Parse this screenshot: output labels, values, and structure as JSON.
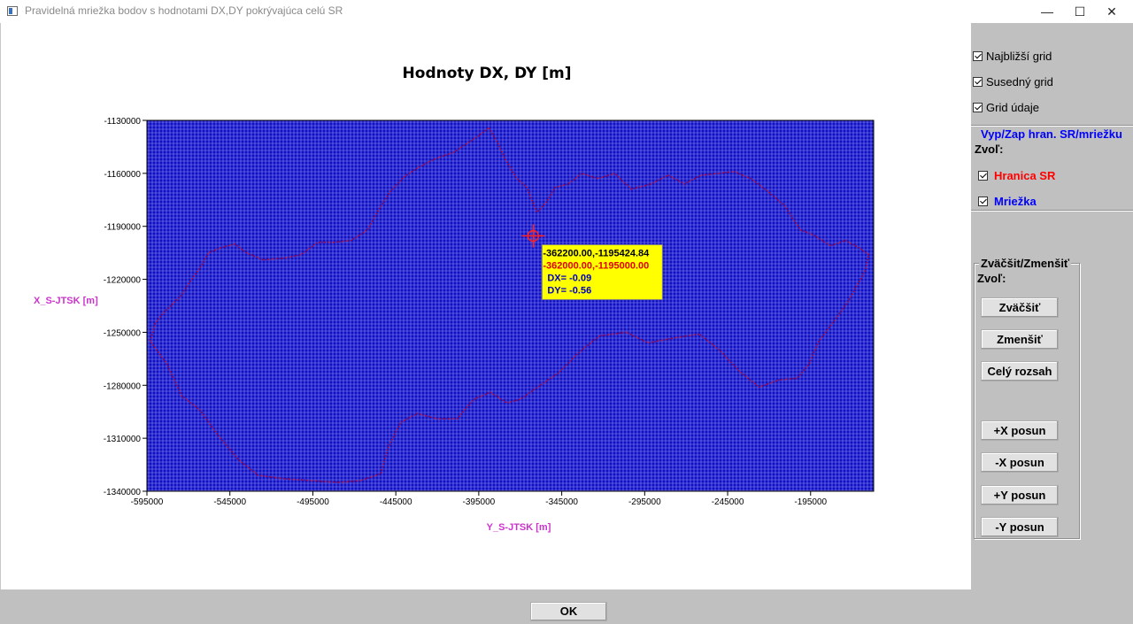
{
  "window": {
    "title": "Pravidelná mriežka bodov s hodnotami DX,DY pokrývajúca celú SR",
    "minimize_icon": "minimize-icon",
    "maximize_icon": "maximize-icon",
    "close_icon": "close-icon"
  },
  "chart_data": {
    "type": "scatter",
    "title": "Hodnoty DX, DY [m]",
    "xlabel": "Y_S-JTSK [m]",
    "ylabel": "X_S-JTSK [m]",
    "xlim": [
      -595000,
      -157000
    ],
    "ylim": [
      -1340000,
      -1130000
    ],
    "x_ticks": [
      -595000,
      -545000,
      -495000,
      -445000,
      -395000,
      -345000,
      -295000,
      -245000,
      -195000
    ],
    "y_ticks": [
      -1130000,
      -1160000,
      -1190000,
      -1220000,
      -1250000,
      -1280000,
      -1310000,
      -1340000
    ],
    "x_tick_labels": [
      "-595000",
      "-545000",
      "-495000",
      "-445000",
      "-395000",
      "-345000",
      "-295000",
      "-245000",
      "-195000"
    ],
    "y_tick_labels": [
      "-1130000",
      "-1160000",
      "-1190000",
      "-1220000",
      "-1250000",
      "-1280000",
      "-1310000",
      "-1340000"
    ],
    "grid": true,
    "grid_color": "#ffffff",
    "plot_background": "#1010c8",
    "series": [
      {
        "name": "Hranica SR",
        "color": "#b00030",
        "style": "dotted",
        "points": [
          [
            -593000,
            -1255000
          ],
          [
            -590000,
            -1245000
          ],
          [
            -584000,
            -1238000
          ],
          [
            -575000,
            -1230000
          ],
          [
            -568000,
            -1220000
          ],
          [
            -562000,
            -1212000
          ],
          [
            -558000,
            -1205000
          ],
          [
            -550000,
            -1202000
          ],
          [
            -542000,
            -1200000
          ],
          [
            -535000,
            -1205000
          ],
          [
            -525000,
            -1209000
          ],
          [
            -512000,
            -1208000
          ],
          [
            -502000,
            -1206000
          ],
          [
            -492000,
            -1199000
          ],
          [
            -482000,
            -1199000
          ],
          [
            -472000,
            -1198000
          ],
          [
            -462000,
            -1192000
          ],
          [
            -455000,
            -1180000
          ],
          [
            -448000,
            -1170000
          ],
          [
            -440000,
            -1162000
          ],
          [
            -432000,
            -1157000
          ],
          [
            -422000,
            -1152000
          ],
          [
            -410000,
            -1148000
          ],
          [
            -402000,
            -1143000
          ],
          [
            -394000,
            -1138000
          ],
          [
            -389000,
            -1134000
          ],
          [
            -384000,
            -1142000
          ],
          [
            -379000,
            -1152000
          ],
          [
            -372000,
            -1163000
          ],
          [
            -366000,
            -1168000
          ],
          [
            -360000,
            -1182000
          ],
          [
            -354000,
            -1176000
          ],
          [
            -349000,
            -1168000
          ],
          [
            -341000,
            -1166000
          ],
          [
            -333000,
            -1160000
          ],
          [
            -323000,
            -1163000
          ],
          [
            -313000,
            -1160000
          ],
          [
            -303000,
            -1169000
          ],
          [
            -291000,
            -1166000
          ],
          [
            -281000,
            -1161000
          ],
          [
            -271000,
            -1166000
          ],
          [
            -261000,
            -1161000
          ],
          [
            -251000,
            -1160000
          ],
          [
            -241000,
            -1159000
          ],
          [
            -231000,
            -1163000
          ],
          [
            -221000,
            -1170000
          ],
          [
            -211000,
            -1178000
          ],
          [
            -201000,
            -1192000
          ],
          [
            -193000,
            -1195000
          ],
          [
            -183000,
            -1201000
          ],
          [
            -174000,
            -1198000
          ],
          [
            -166000,
            -1202000
          ],
          [
            -160000,
            -1206000
          ],
          [
            -162000,
            -1215000
          ],
          [
            -172000,
            -1232000
          ],
          [
            -182000,
            -1245000
          ],
          [
            -190000,
            -1255000
          ],
          [
            -196000,
            -1268000
          ],
          [
            -203000,
            -1276000
          ],
          [
            -214000,
            -1277000
          ],
          [
            -226000,
            -1281000
          ],
          [
            -238000,
            -1272000
          ],
          [
            -250000,
            -1260000
          ],
          [
            -262000,
            -1251000
          ],
          [
            -276000,
            -1253000
          ],
          [
            -293000,
            -1256000
          ],
          [
            -306000,
            -1250000
          ],
          [
            -322000,
            -1252000
          ],
          [
            -333000,
            -1260000
          ],
          [
            -347000,
            -1273000
          ],
          [
            -361000,
            -1282000
          ],
          [
            -370000,
            -1288000
          ],
          [
            -378000,
            -1290000
          ],
          [
            -388000,
            -1284000
          ],
          [
            -398000,
            -1288000
          ],
          [
            -408000,
            -1299000
          ],
          [
            -420000,
            -1299000
          ],
          [
            -432000,
            -1296000
          ],
          [
            -442000,
            -1301000
          ],
          [
            -450000,
            -1316000
          ],
          [
            -454000,
            -1330000
          ],
          [
            -466000,
            -1334000
          ],
          [
            -480000,
            -1335000
          ],
          [
            -496000,
            -1334000
          ],
          [
            -512000,
            -1333000
          ],
          [
            -528000,
            -1331000
          ],
          [
            -540000,
            -1322000
          ],
          [
            -553000,
            -1307000
          ],
          [
            -563000,
            -1294000
          ],
          [
            -574000,
            -1286000
          ],
          [
            -583000,
            -1268000
          ],
          [
            -593000,
            -1255000
          ]
        ]
      }
    ],
    "marker": {
      "x": -362200,
      "y": -1195424.84,
      "color": "#ff2020"
    },
    "tooltip": {
      "line1": "-362200.00,-1195424.84",
      "line2": "-362000.00,-1195000.00",
      "line3": "DX= -0.09",
      "line4": "DY= -0.56",
      "line1_color": "#000000",
      "line2_color": "#e00000",
      "line34_color": "#0000c0",
      "background": "#ffff00"
    }
  },
  "panel": {
    "najblizsi_grid": "Najbližší grid",
    "susedny_grid": "Susedný grid",
    "grid_udaje": "Grid údaje",
    "vyp_zap_title": "Vyp/Zap hran. SR/mriežku",
    "zvol_1": "Zvoľ:",
    "hranica_sr": "Hranica SR",
    "mriezka": "Mriežka",
    "zvacsit_zmensit_title": "Zväčšit/Zmenšiť",
    "zvol_2": "Zvoľ:",
    "buttons": {
      "zvacsit": "Zväčšiť",
      "zmensit": "Zmenšiť",
      "cely_rozsah": "Celý rozsah",
      "plus_x": "+X posun",
      "minus_x": "-X posun",
      "plus_y": "+Y posun",
      "minus_y": "-Y posun"
    },
    "colors": {
      "hranica": "#ff0000",
      "mriezka": "#0000ff",
      "title_blue": "#0000ff"
    }
  },
  "footer": {
    "ok": "OK"
  }
}
